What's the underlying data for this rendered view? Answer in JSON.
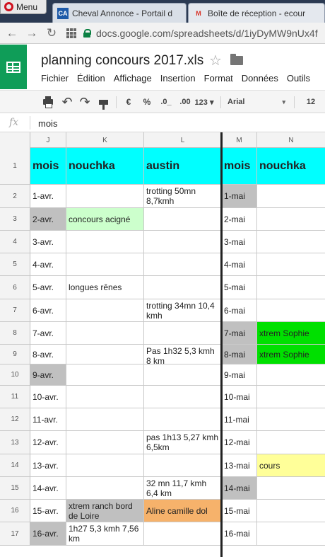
{
  "browser": {
    "menu_label": "Menu",
    "tabs": [
      {
        "title": "Cheval Annonce - Portail d",
        "icon": "cheval-annonce-icon",
        "favicon_text": "CA"
      },
      {
        "title": "Boîte de réception - ecour",
        "icon": "gmail-icon",
        "favicon_text": "M"
      }
    ],
    "url": "docs.google.com/spreadsheets/d/1iyDyMW9nUx4f"
  },
  "sheets": {
    "title": "planning concours 2017.xls",
    "menu": [
      "Fichier",
      "Édition",
      "Affichage",
      "Insertion",
      "Format",
      "Données",
      "Outils"
    ],
    "toolbar": {
      "currency": "€",
      "percent": "%",
      "dec_decrease": ".0_",
      "dec_increase": ".00",
      "format_more": "123 ▾",
      "font": "Arial",
      "font_size": "12"
    },
    "formula_bar": {
      "fx": "fx",
      "value": "mois"
    }
  },
  "columns": [
    {
      "letter": "J"
    },
    {
      "letter": "K"
    },
    {
      "letter": "L"
    },
    {
      "letter": "M"
    },
    {
      "letter": "N"
    }
  ],
  "colors": {
    "header_fill": "#00ffff",
    "gray_fill": "#c0c0c0",
    "light_green": "#ccffcc",
    "green": "#00e000",
    "orange": "#f6b26b",
    "yellow": "#ffff99"
  },
  "rows": [
    {
      "num": "1",
      "cells": [
        "mois",
        "nouchka",
        "austin",
        "mois",
        "nouchka"
      ]
    },
    {
      "num": "2",
      "cells": [
        "1-avr.",
        "",
        "trotting 50mn 8,7kmh",
        "1-mai",
        ""
      ]
    },
    {
      "num": "3",
      "cells": [
        "2-avr.",
        "concours acigné",
        "",
        "2-mai",
        ""
      ]
    },
    {
      "num": "4",
      "cells": [
        "3-avr.",
        "",
        "",
        "3-mai",
        ""
      ]
    },
    {
      "num": "5",
      "cells": [
        "4-avr.",
        "",
        "",
        "4-mai",
        ""
      ]
    },
    {
      "num": "6",
      "cells": [
        "5-avr.",
        "longues rênes",
        "",
        "5-mai",
        ""
      ]
    },
    {
      "num": "7",
      "cells": [
        "6-avr.",
        "",
        "trotting 34mn 10,4 kmh",
        "6-mai",
        ""
      ]
    },
    {
      "num": "8",
      "cells": [
        "7-avr.",
        "",
        "",
        "7-mai",
        "xtrem Sophie"
      ]
    },
    {
      "num": "9",
      "cells": [
        "8-avr.",
        "",
        "Pas 1h32 5,3 kmh 8 km",
        "8-mai",
        "xtrem Sophie"
      ]
    },
    {
      "num": "10",
      "cells": [
        "9-avr.",
        "",
        "",
        "9-mai",
        ""
      ]
    },
    {
      "num": "11",
      "cells": [
        "10-avr.",
        "",
        "",
        "10-mai",
        ""
      ]
    },
    {
      "num": "12",
      "cells": [
        "11-avr.",
        "",
        "",
        "11-mai",
        ""
      ]
    },
    {
      "num": "13",
      "cells": [
        "12-avr.",
        "",
        "pas 1h13 5,27 kmh 6,5km",
        "12-mai",
        ""
      ]
    },
    {
      "num": "14",
      "cells": [
        "13-avr.",
        "",
        "",
        "13-mai",
        "cours"
      ]
    },
    {
      "num": "15",
      "cells": [
        "14-avr.",
        "",
        "32 mn 11,7 kmh 6,4 km",
        "14-mai",
        ""
      ]
    },
    {
      "num": "16",
      "cells": [
        "15-avr.",
        "xtrem ranch bord de Loire",
        "Aline camille dol",
        "15-mai",
        ""
      ]
    },
    {
      "num": "17",
      "cells": [
        "16-avr.",
        "1h27 5,3 kmh 7,56 km",
        "",
        "16-mai",
        ""
      ]
    }
  ]
}
